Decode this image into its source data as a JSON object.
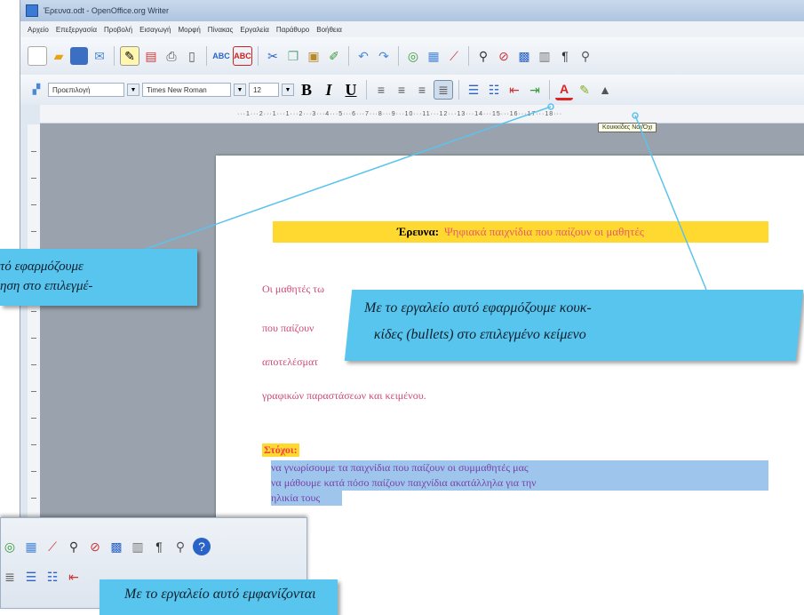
{
  "window": {
    "title": "Έρευνα.odt - OpenOffice.org Writer"
  },
  "menu": [
    "Αρχείο",
    "Επεξεργασία",
    "Προβολή",
    "Εισαγωγή",
    "Μορφή",
    "Πίνακας",
    "Εργαλεία",
    "Παράθυρο",
    "Βοήθεια"
  ],
  "format_bar": {
    "style": "Προεπιλογή",
    "font": "Times New Roman",
    "size": "12"
  },
  "tooltip": "Κουκκίδες Ναι/Όχι",
  "document": {
    "heading_bold": "Έρευνα:",
    "heading_rest": "Ψηφιακά παιχνίδια που παίζουν οι μαθητές",
    "para_lines": [
      "Οι μαθητές τω",
      "που παίζουν",
      "αποτελέσματ",
      "γραφικών παραστάσεων και κειμένου."
    ],
    "goals_label": "Στόχοι:",
    "selected_lines": [
      "να γνωρίσουμε τα παιχνίδια που παίζουν οι συμμαθητές μας",
      "να μάθουμε κατά πόσο παίζουν παιχνίδια ακατάλληλα για την",
      "ηλικία τους"
    ]
  },
  "callouts": {
    "left": [
      "τό εφαρμόζουμε",
      "ηση στο επιλεγμέ-"
    ],
    "right": [
      "Με το εργαλείο αυτό εφαρμόζουμε κουκ-",
      "κίδες (bullets) στο επιλεγμένο κείμενο"
    ],
    "bottom": "Με το εργαλείο αυτό εμφανίζονται"
  },
  "colors": {
    "callout": "#58c5ee",
    "highlight": "#ffd830",
    "selection": "#9ec6ec",
    "body_text": "#d04878"
  }
}
